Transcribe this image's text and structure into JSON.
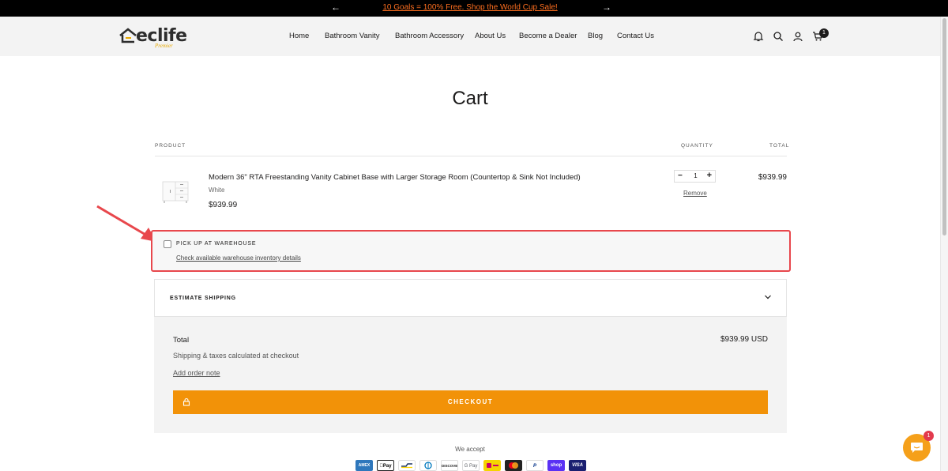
{
  "announcement": {
    "prev_icon": "arrow-left-icon",
    "text": "10 Goals = 100% Free. Shop the World Cup Sale!",
    "next_icon": "arrow-right-icon",
    "text_color": "#ff6f1f"
  },
  "logo": {
    "word": "eclife",
    "sub": "Premier"
  },
  "nav": {
    "items": [
      "Home",
      "Bathroom Vanity",
      "Bathroom Accessory",
      "About Us",
      "Become a Dealer",
      "Blog",
      "Contact Us"
    ]
  },
  "header_icons": [
    "bell-icon",
    "search-icon",
    "account-icon",
    "cart-icon"
  ],
  "cart_count": "1",
  "page": {
    "title": "Cart"
  },
  "table": {
    "col_product": "PRODUCT",
    "col_quantity": "QUANTITY",
    "col_total": "TOTAL"
  },
  "item": {
    "name": "Modern 36\" RTA Freestanding Vanity Cabinet Base with Larger Storage Room (Countertop & Sink Not Included)",
    "variant": "White",
    "price": "$939.99",
    "quantity": "1",
    "remove_label": "Remove",
    "line_total": "$939.99"
  },
  "pickup": {
    "label": "PICK UP AT WAREHOUSE",
    "link": "Check available warehouse inventory details",
    "highlight_color": "#e8474c"
  },
  "shipping": {
    "label": "ESTIMATE SHIPPING"
  },
  "summary": {
    "total_label": "Total",
    "total_value": "$939.99 USD",
    "shipping_note": "Shipping & taxes calculated at checkout",
    "order_note": "Add order note",
    "checkout_label": "CHECKOUT",
    "checkout_color": "#f29208"
  },
  "payments": {
    "label": "We accept",
    "methods": [
      "AMEX",
      "Pay",
      "",
      "",
      "DISCOVER",
      "G Pay",
      "",
      "",
      "P",
      "shop",
      "VISA"
    ]
  },
  "chat": {
    "badge": "1"
  }
}
